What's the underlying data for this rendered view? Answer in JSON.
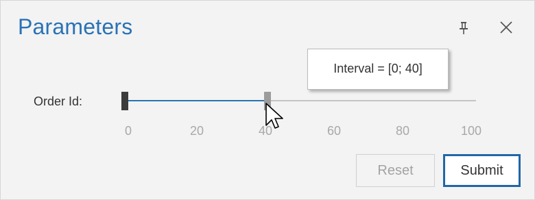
{
  "dialog": {
    "title": "Parameters",
    "pin_icon": "pin-icon",
    "close_icon": "close-icon"
  },
  "parameter": {
    "label": "Order Id:",
    "range": {
      "min": 0,
      "max": 100
    },
    "selected": {
      "start": 0,
      "end": 40
    },
    "ticks": [
      "0",
      "20",
      "40",
      "60",
      "80",
      "100"
    ]
  },
  "tooltip": {
    "text": "Interval = [0; 40]"
  },
  "buttons": {
    "reset_label": "Reset",
    "submit_label": "Submit"
  },
  "colors": {
    "accent": "#2a72b5",
    "track": "#c4c4c4",
    "panel_bg": "#f3f3f3",
    "submit_border": "#2166a8"
  }
}
